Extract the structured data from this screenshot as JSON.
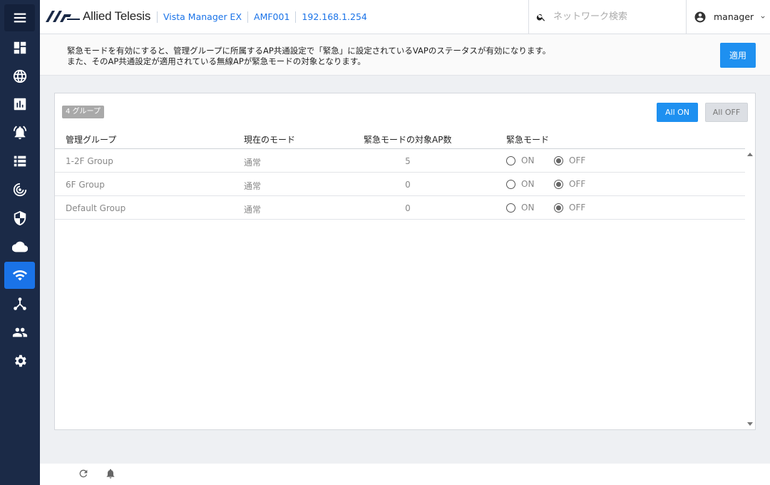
{
  "brand": {
    "logo_text": "Allied Telesis",
    "accent": "#1a73e8"
  },
  "header": {
    "breadcrumbs": [
      "Vista Manager EX",
      "AMF001",
      "192.168.1.254"
    ],
    "search_placeholder": "ネットワーク検索",
    "user_name": "manager"
  },
  "sidebar": {
    "items": [
      {
        "icon": "menu-icon"
      },
      {
        "icon": "dashboard-icon"
      },
      {
        "icon": "globe-icon"
      },
      {
        "icon": "chart-icon"
      },
      {
        "icon": "alarm-icon"
      },
      {
        "icon": "list-icon"
      },
      {
        "icon": "radar-icon"
      },
      {
        "icon": "shield-icon"
      },
      {
        "icon": "cloud-icon"
      },
      {
        "icon": "wifi-icon",
        "active": true
      },
      {
        "icon": "network-icon"
      },
      {
        "icon": "people-icon"
      },
      {
        "icon": "gear-icon"
      }
    ]
  },
  "notice": {
    "line1": "緊急モードを有効にすると、管理グループに所属するAP共通設定で「緊急」に設定されているVAPのステータスが有効になります。",
    "line2": "また、そのAP共通設定が適用されている無線APが緊急モードの対象となります。",
    "apply_label": "適用"
  },
  "panel": {
    "count_badge": "4 グループ",
    "all_on_label": "All ON",
    "all_off_label": "All OFF",
    "columns": [
      "管理グループ",
      "現在のモード",
      "緊急モードの対象AP数",
      "緊急モード"
    ],
    "rows": [
      {
        "group": "1-2F Group",
        "mode": "通常",
        "ap_count": "5",
        "on_label": "ON",
        "off_label": "OFF",
        "emergency": "OFF"
      },
      {
        "group": "6F Group",
        "mode": "通常",
        "ap_count": "0",
        "on_label": "ON",
        "off_label": "OFF",
        "emergency": "OFF"
      },
      {
        "group": "Default Group",
        "mode": "通常",
        "ap_count": "0",
        "on_label": "ON",
        "off_label": "OFF",
        "emergency": "OFF"
      }
    ]
  },
  "footer": {
    "icons": [
      "refresh-icon",
      "bell-icon"
    ]
  }
}
